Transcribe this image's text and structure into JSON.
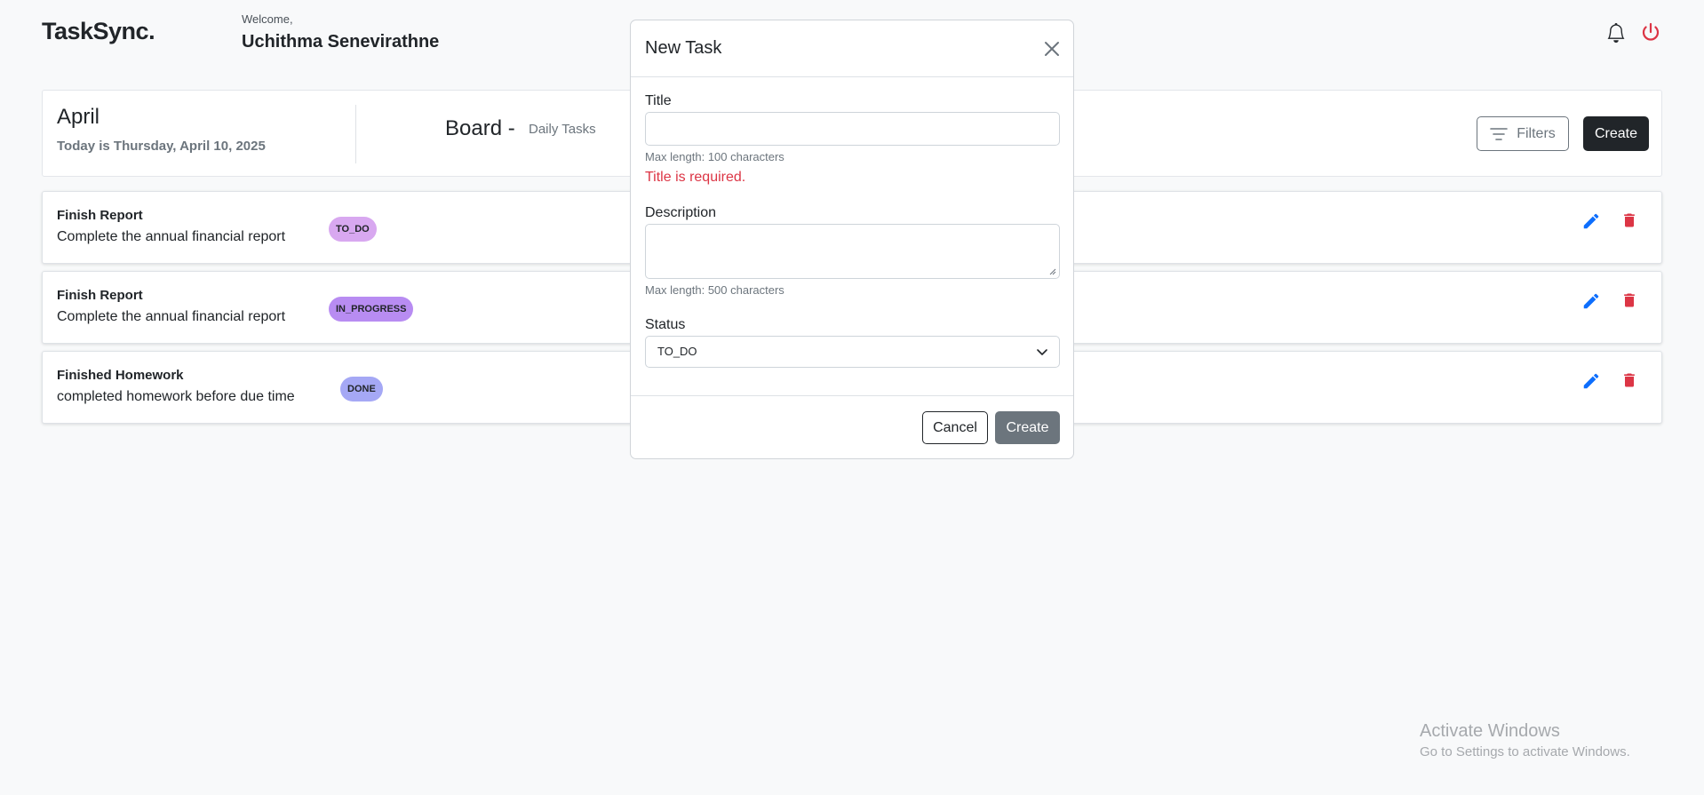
{
  "header": {
    "logo": "TaskSync.",
    "welcome_label": "Welcome,",
    "user_name": "Uchithma Senevirathne",
    "bell_icon": "bell-icon",
    "power_icon": "power-icon",
    "power_color": "#dc3545"
  },
  "board": {
    "month": "April",
    "today": "Today is Thursday, April 10, 2025",
    "title": "Board -",
    "subtitle": "Daily Tasks",
    "filters_label": "Filters",
    "create_label": "Create"
  },
  "tasks": [
    {
      "title": "Finish Report",
      "description": "Complete the annual financial report",
      "status": "TO_DO",
      "badge_color": "#d8a8f0"
    },
    {
      "title": "Finish Report",
      "description": "Complete the annual financial report",
      "status": "IN_PROGRESS",
      "badge_color": "#b88cf2"
    },
    {
      "title": "Finished Homework",
      "description": "completed homework before due time",
      "status": "DONE",
      "badge_color": "#a5a8f5"
    }
  ],
  "modal": {
    "title": "New Task",
    "title_label": "Title",
    "title_value": "",
    "title_hint": "Max length: 100 characters",
    "title_error": "Title is required.",
    "description_label": "Description",
    "description_value": "",
    "description_hint": "Max length: 500 characters",
    "status_label": "Status",
    "status_value": "TO_DO",
    "cancel_label": "Cancel",
    "create_label": "Create"
  },
  "watermark": {
    "line1": "Activate Windows",
    "line2": "Go to Settings to activate Windows."
  },
  "colors": {
    "edit_icon": "#0d6efd",
    "delete_icon": "#dc3545",
    "error": "#dc3545"
  }
}
